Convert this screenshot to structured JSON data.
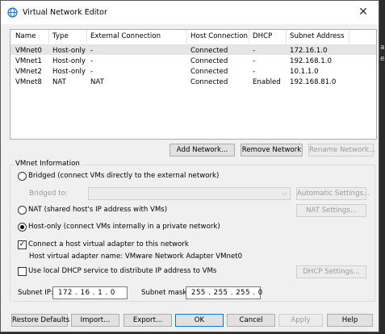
{
  "window": {
    "title": "Virtual Network Editor",
    "close_glyph": "✕"
  },
  "network_list": {
    "columns": [
      "Name",
      "Type",
      "External Connection",
      "Host Connection",
      "DHCP",
      "Subnet Address"
    ],
    "rows": [
      [
        "VMnet0",
        "Host-only",
        "-",
        "Connected",
        "-",
        "172.16.1.0"
      ],
      [
        "VMnet1",
        "Host-only",
        "-",
        "Connected",
        "-",
        "192.168.1.0"
      ],
      [
        "VMnet2",
        "Host-only",
        "-",
        "Connected",
        "-",
        "10.1.1.0"
      ],
      [
        "VMnet8",
        "NAT",
        "NAT",
        "Connected",
        "Enabled",
        "192.168.81.0"
      ]
    ]
  },
  "list_buttons": {
    "add_network": "Add Network...",
    "remove_network": "Remove Network",
    "rename_network": "Rename Network..."
  },
  "vmnet_info": {
    "group_title": "VMnet Information",
    "bridged_label": "Bridged (connect VMs directly to the external network)",
    "bridged_to_label": "Bridged to:",
    "bridged_to_value": "",
    "automatic_settings": "Automatic Settings...",
    "nat_label": "NAT (shared host's IP address with VMs)",
    "nat_settings": "NAT Settings...",
    "hostonly_label": "Host-only (connect VMs internally in a private network)",
    "selected_mode": "host-only",
    "connect_adapter_label": "Connect a host virtual adapter to this network",
    "connect_adapter_checked": true,
    "adapter_name_text": "Host virtual adapter name: VMware Network Adapter VMnet0",
    "dhcp_label": "Use local DHCP service to distribute IP address to VMs",
    "dhcp_checked": false,
    "dhcp_settings": "DHCP Settings...",
    "subnet_ip_label": "Subnet IP:",
    "subnet_ip_value": "172 . 16 . 1 . 0",
    "subnet_mask_label": "Subnet mask:",
    "subnet_mask_value": "255 . 255 . 255 . 0"
  },
  "footer": {
    "restore_defaults": "Restore Defaults",
    "import": "Import...",
    "export": "Export...",
    "ok": "OK",
    "cancel": "Cancel",
    "apply": "Apply",
    "help": "Help"
  },
  "background_fragments": [
    "a",
    "e"
  ],
  "icons": {
    "title": "network-globe-icon",
    "check_mark": "✓"
  }
}
